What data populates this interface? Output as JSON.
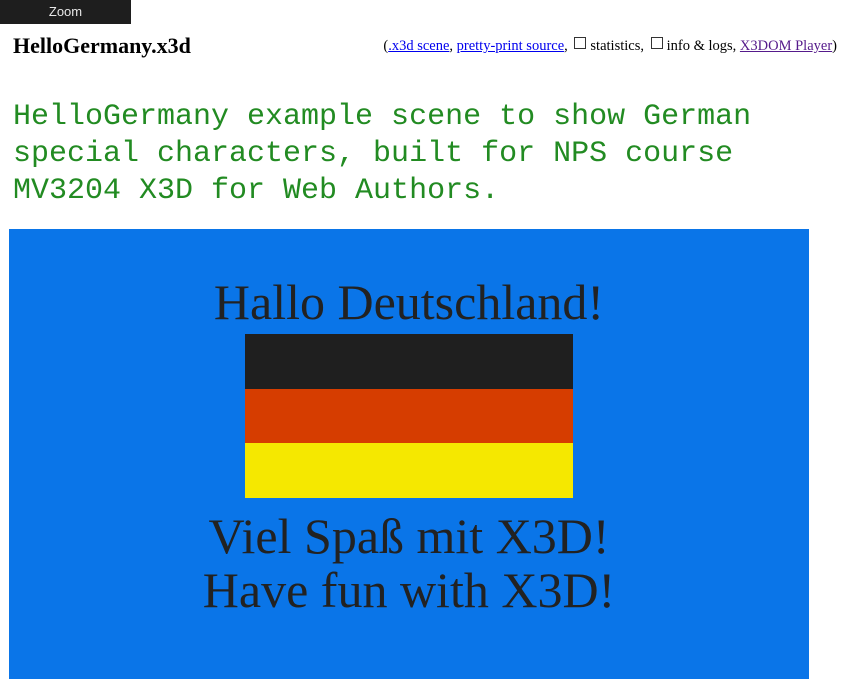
{
  "toolbar": {
    "zoom_label": "Zoom"
  },
  "header": {
    "title": "HelloGermany.x3d",
    "paren_open": "(",
    "link_x3d_scene": ".x3d scene",
    "sep1": ",",
    "link_pretty_print": "pretty-print source",
    "sep2": ",",
    "statistics_label": "statistics,",
    "info_logs_label": "info & logs,",
    "link_x3dom_player": "X3DOM Player",
    "paren_close": ")"
  },
  "description": "HelloGermany example scene to show German special characters, built for NPS course MV3204 X3D for Web Authors.",
  "scene": {
    "background_color": "#0a75e8",
    "text_top": "Hallo Deutschland!",
    "text_line2": "Viel Spaß mit X3D!",
    "text_line3": "Have fun with X3D!",
    "flag_colors": [
      "#1f1f1f",
      "#d63d00",
      "#f5e800"
    ]
  },
  "colors": {
    "description_text": "#228b22",
    "link": "#0000ee",
    "visited_link": "#551a8b"
  }
}
